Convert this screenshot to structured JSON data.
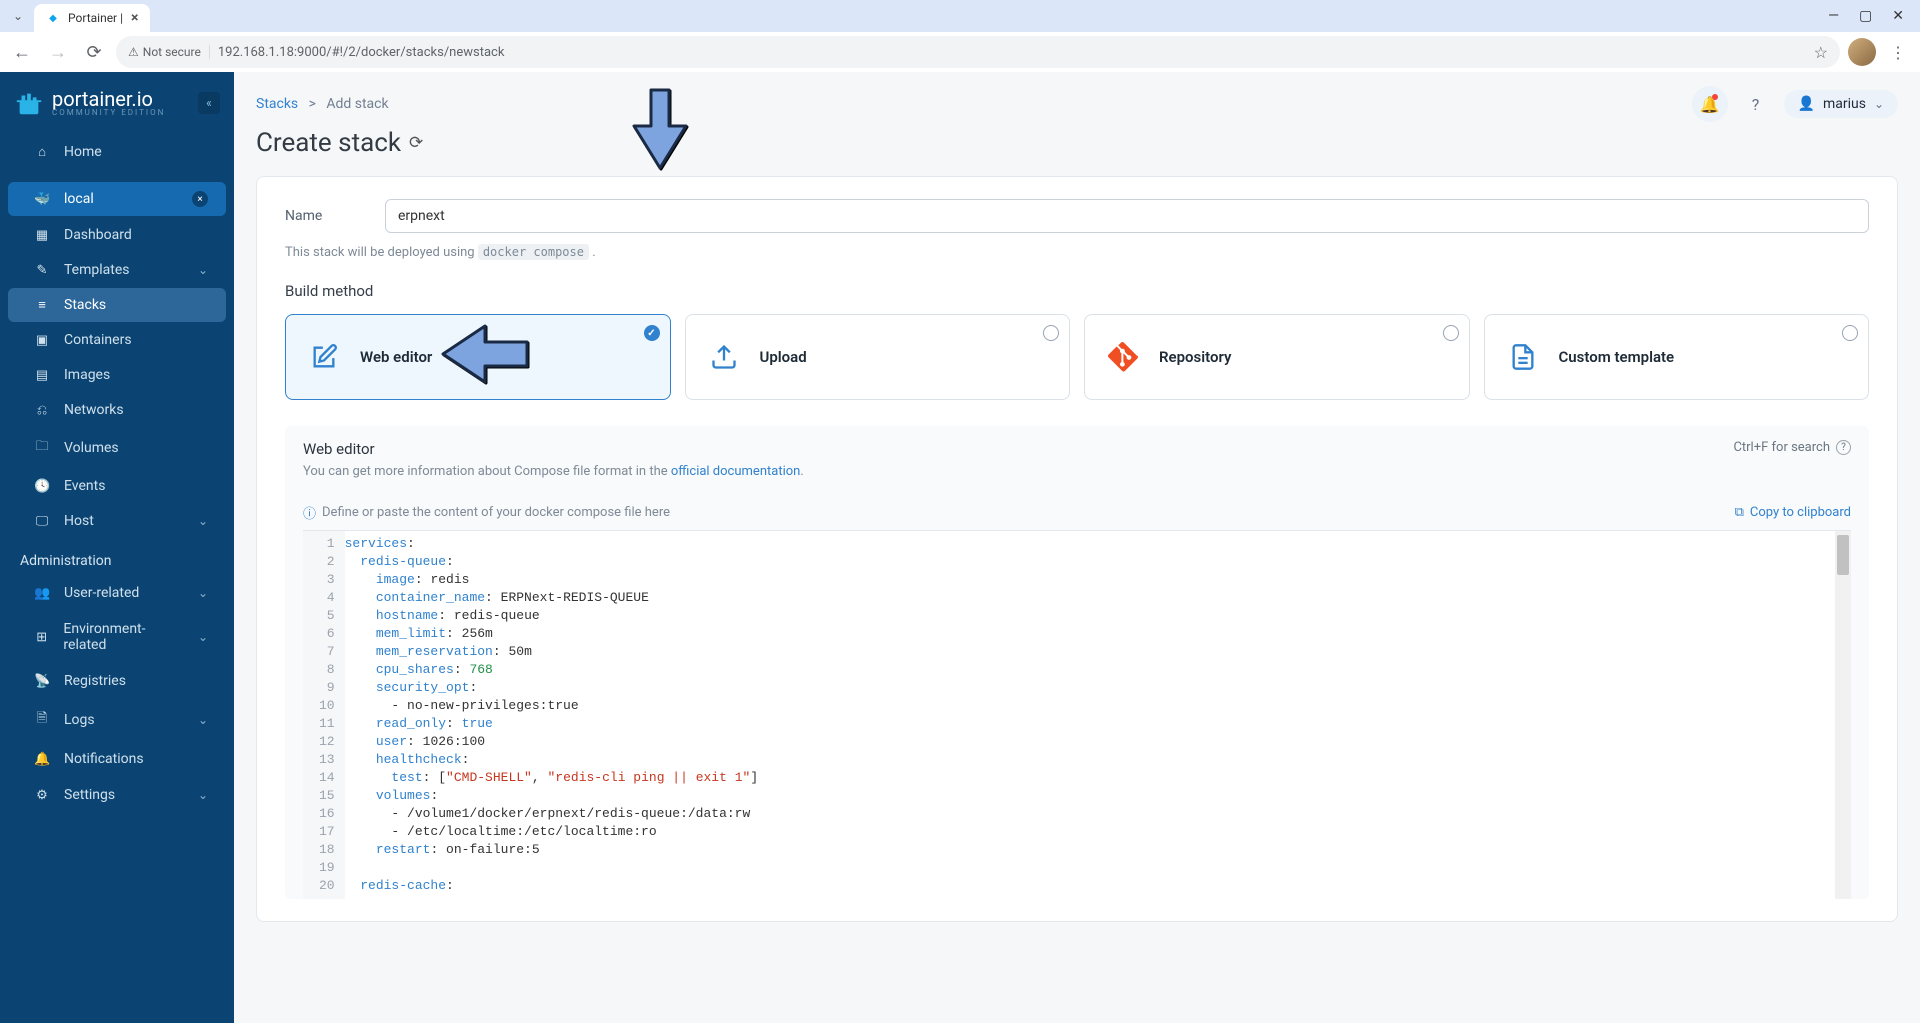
{
  "browser": {
    "tab_title": "Portainer |",
    "url_display": "192.168.1.18:9000/#!/2/docker/stacks/newstack",
    "security_label": "Not secure"
  },
  "brand": {
    "name": "portainer.io",
    "sub": "COMMUNITY EDITION"
  },
  "sidebar": {
    "home": "Home",
    "env": {
      "name": "local"
    },
    "items": [
      "Dashboard",
      "Templates",
      "Stacks",
      "Containers",
      "Images",
      "Networks",
      "Volumes",
      "Events",
      "Host"
    ],
    "admin_label": "Administration",
    "admin_items": [
      "User-related",
      "Environment-related",
      "Registries",
      "Logs",
      "Notifications",
      "Settings"
    ]
  },
  "breadcrumb": {
    "root": "Stacks",
    "sep": ">",
    "current": "Add stack"
  },
  "page_title": "Create stack",
  "user": {
    "name": "marius"
  },
  "form": {
    "name_label": "Name",
    "name_value": "erpnext",
    "hint_pre": "This stack will be deployed using ",
    "hint_code": "docker compose",
    "hint_post": " ."
  },
  "build": {
    "label": "Build method",
    "cards": [
      {
        "title": "Web editor"
      },
      {
        "title": "Upload"
      },
      {
        "title": "Repository"
      },
      {
        "title": "Custom template"
      }
    ]
  },
  "editor": {
    "title": "Web editor",
    "sub_pre": "You can get more information about Compose file format in the ",
    "sub_link": "official documentation",
    "sub_post": ".",
    "search_hint": "Ctrl+F for search",
    "define_hint": "Define or paste the content of your docker compose file here",
    "copy_label": "Copy to clipboard"
  },
  "code": {
    "lines": [
      [
        [
          "key",
          "services"
        ],
        [
          "punct",
          ":"
        ]
      ],
      [
        [
          "plain",
          "  "
        ],
        [
          "key",
          "redis-queue"
        ],
        [
          "punct",
          ":"
        ]
      ],
      [
        [
          "plain",
          "    "
        ],
        [
          "key",
          "image"
        ],
        [
          "punct",
          ": "
        ],
        [
          "plain",
          "redis"
        ]
      ],
      [
        [
          "plain",
          "    "
        ],
        [
          "key",
          "container_name"
        ],
        [
          "punct",
          ": "
        ],
        [
          "plain",
          "ERPNext-REDIS-QUEUE"
        ]
      ],
      [
        [
          "plain",
          "    "
        ],
        [
          "key",
          "hostname"
        ],
        [
          "punct",
          ": "
        ],
        [
          "plain",
          "redis-queue"
        ]
      ],
      [
        [
          "plain",
          "    "
        ],
        [
          "key",
          "mem_limit"
        ],
        [
          "punct",
          ": "
        ],
        [
          "plain",
          "256m"
        ]
      ],
      [
        [
          "plain",
          "    "
        ],
        [
          "key",
          "mem_reservation"
        ],
        [
          "punct",
          ": "
        ],
        [
          "plain",
          "50m"
        ]
      ],
      [
        [
          "plain",
          "    "
        ],
        [
          "key",
          "cpu_shares"
        ],
        [
          "punct",
          ": "
        ],
        [
          "num",
          "768"
        ]
      ],
      [
        [
          "plain",
          "    "
        ],
        [
          "key",
          "security_opt"
        ],
        [
          "punct",
          ":"
        ]
      ],
      [
        [
          "plain",
          "      - no-new-privileges:true"
        ]
      ],
      [
        [
          "plain",
          "    "
        ],
        [
          "key",
          "read_only"
        ],
        [
          "punct",
          ": "
        ],
        [
          "bool",
          "true"
        ]
      ],
      [
        [
          "plain",
          "    "
        ],
        [
          "key",
          "user"
        ],
        [
          "punct",
          ": "
        ],
        [
          "plain",
          "1026:100"
        ]
      ],
      [
        [
          "plain",
          "    "
        ],
        [
          "key",
          "healthcheck"
        ],
        [
          "punct",
          ":"
        ]
      ],
      [
        [
          "plain",
          "      "
        ],
        [
          "key",
          "test"
        ],
        [
          "punct",
          ": ["
        ],
        [
          "str",
          "\"CMD-SHELL\""
        ],
        [
          "punct",
          ", "
        ],
        [
          "str",
          "\"redis-cli ping || exit 1\""
        ],
        [
          "punct",
          "]"
        ]
      ],
      [
        [
          "plain",
          "    "
        ],
        [
          "key",
          "volumes"
        ],
        [
          "punct",
          ":"
        ]
      ],
      [
        [
          "plain",
          "      - /volume1/docker/erpnext/redis-queue:/data:rw"
        ]
      ],
      [
        [
          "plain",
          "      - /etc/localtime:/etc/localtime:ro"
        ]
      ],
      [
        [
          "plain",
          "    "
        ],
        [
          "key",
          "restart"
        ],
        [
          "punct",
          ": "
        ],
        [
          "plain",
          "on-failure:5"
        ]
      ],
      [
        [
          "plain",
          ""
        ]
      ],
      [
        [
          "plain",
          "  "
        ],
        [
          "key",
          "redis-cache"
        ],
        [
          "punct",
          ":"
        ]
      ]
    ]
  }
}
